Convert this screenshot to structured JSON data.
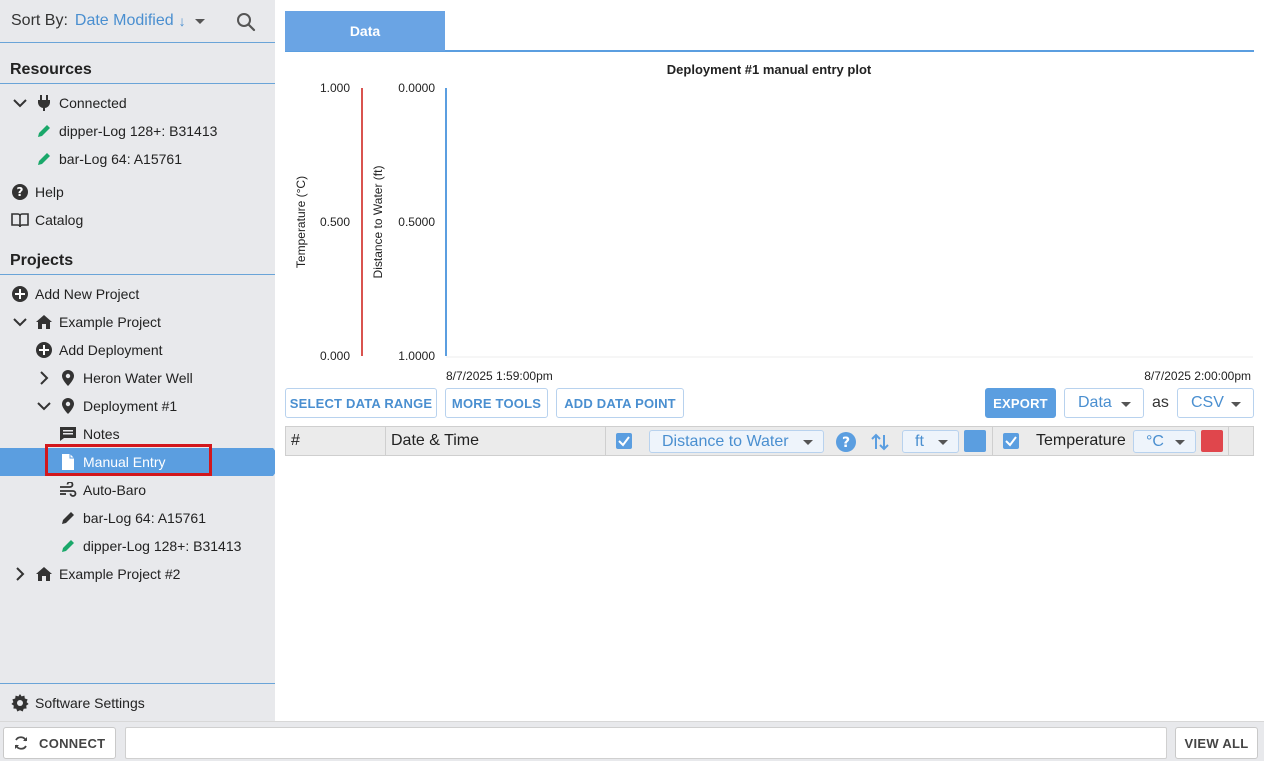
{
  "sidebar": {
    "sort_label": "Sort By:",
    "sort_value": "Date Modified",
    "sort_direction_glyph": "↓",
    "resources_title": "Resources",
    "resources": {
      "connected": "Connected",
      "device1": "dipper-Log 128+: B31413",
      "device2": "bar-Log 64: A15761",
      "help": "Help",
      "catalog": "Catalog"
    },
    "projects_title": "Projects",
    "projects": {
      "add_new": "Add New Project",
      "example": "Example Project",
      "add_deployment": "Add Deployment",
      "heron": "Heron Water Well",
      "deployment1": "Deployment #1",
      "notes": "Notes",
      "manual_entry": "Manual Entry",
      "auto_baro": "Auto-Baro",
      "barlog": "bar-Log 64: A15761",
      "dipperlog": "dipper-Log 128+: B31413",
      "example2": "Example Project #2"
    },
    "settings": "Software Settings"
  },
  "main": {
    "tab": "Data",
    "toolbar": {
      "select_range": "SELECT DATA RANGE",
      "more_tools": "MORE TOOLS",
      "add_point": "ADD DATA POINT",
      "export": "EXPORT",
      "export_what": "Data",
      "as": "as",
      "format": "CSV"
    },
    "table": {
      "col_num": "#",
      "col_datetime": "Date & Time",
      "series1": "Distance to Water",
      "series1_unit": "ft",
      "series2": "Temperature",
      "series2_unit": "°C"
    }
  },
  "chart_data": {
    "type": "line",
    "title": "Deployment #1 manual entry plot",
    "x_ticks": [
      "8/7/2025 1:59:00pm",
      "8/7/2025 2:00:00pm"
    ],
    "y_axes": [
      {
        "label": "Temperature (°C)",
        "ticks": [
          "1.000",
          "0.500",
          "0.000"
        ],
        "range": [
          0,
          1
        ],
        "color": "#d9534f"
      },
      {
        "label": "Distance to Water (ft)",
        "ticks": [
          "0.0000",
          "0.5000",
          "1.0000"
        ],
        "range": [
          0,
          1
        ],
        "inverted": true,
        "color": "#5b9ee0"
      }
    ],
    "series": []
  },
  "bottom": {
    "connect": "CONNECT",
    "view_all": "VIEW ALL"
  },
  "colors": {
    "accent": "#5b9ee0",
    "temp_series": "#e0464c",
    "distance_series": "#5b9ee0",
    "highlight": "#d2171c"
  }
}
